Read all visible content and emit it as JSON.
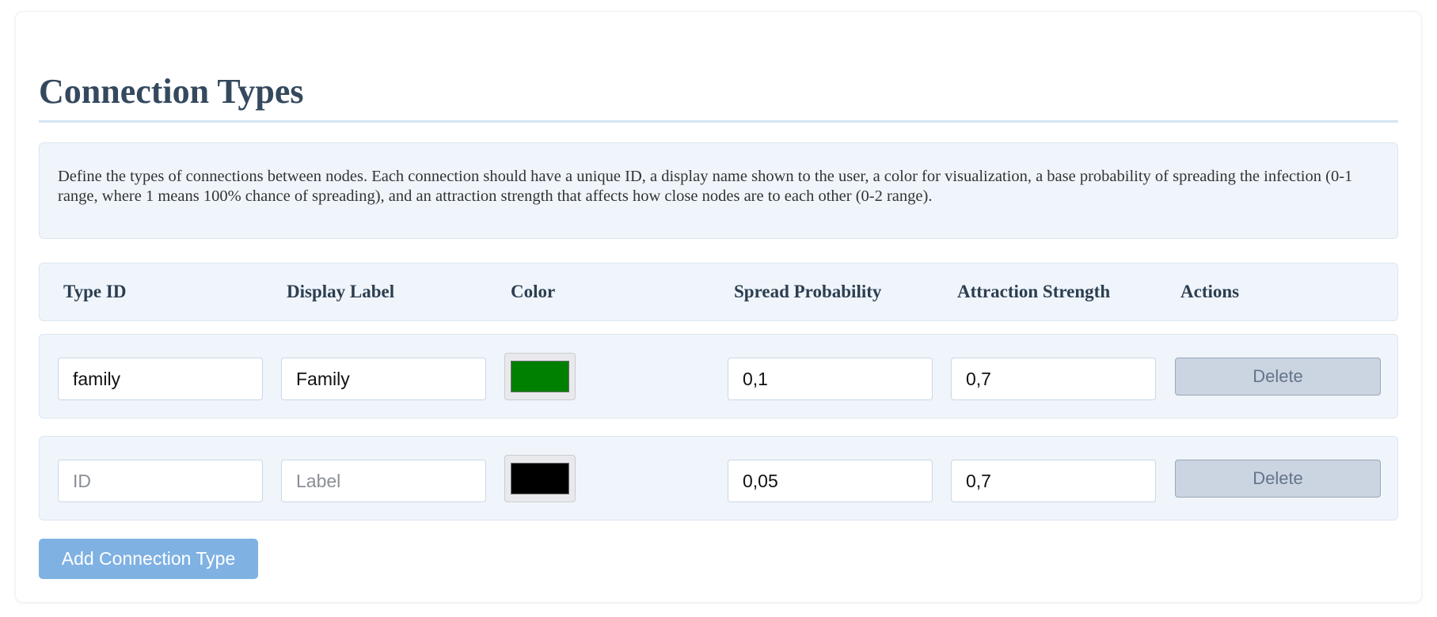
{
  "page": {
    "title": "Connection Types",
    "description": "Define the types of connections between nodes. Each connection should have a unique ID, a display name shown to the user, a color for visualization, a base probability of spreading the infection (0-1 range, where 1 means 100% chance of spreading), and an attraction strength that affects how close nodes are to each other (0-2 range)."
  },
  "table": {
    "headers": {
      "type_id": "Type ID",
      "display_label": "Display Label",
      "color": "Color",
      "spread_probability": "Spread Probability",
      "attraction_strength": "Attraction Strength",
      "actions": "Actions"
    },
    "rows": [
      {
        "id_value": "family",
        "id_placeholder": "ID",
        "label_value": "Family",
        "label_placeholder": "Label",
        "color": "#008000",
        "spread_probability": "0,1",
        "attraction_strength": "0,7",
        "delete_label": "Delete"
      },
      {
        "id_value": "",
        "id_placeholder": "ID",
        "label_value": "",
        "label_placeholder": "Label",
        "color": "#000000",
        "spread_probability": "0,05",
        "attraction_strength": "0,7",
        "delete_label": "Delete"
      }
    ]
  },
  "add_button_label": "Add Connection Type",
  "colors": {
    "accent": "#7fb1e3",
    "title": "#34495e",
    "panel_bg": "#f0f5fb",
    "delete_bg": "#cbd5e1"
  }
}
